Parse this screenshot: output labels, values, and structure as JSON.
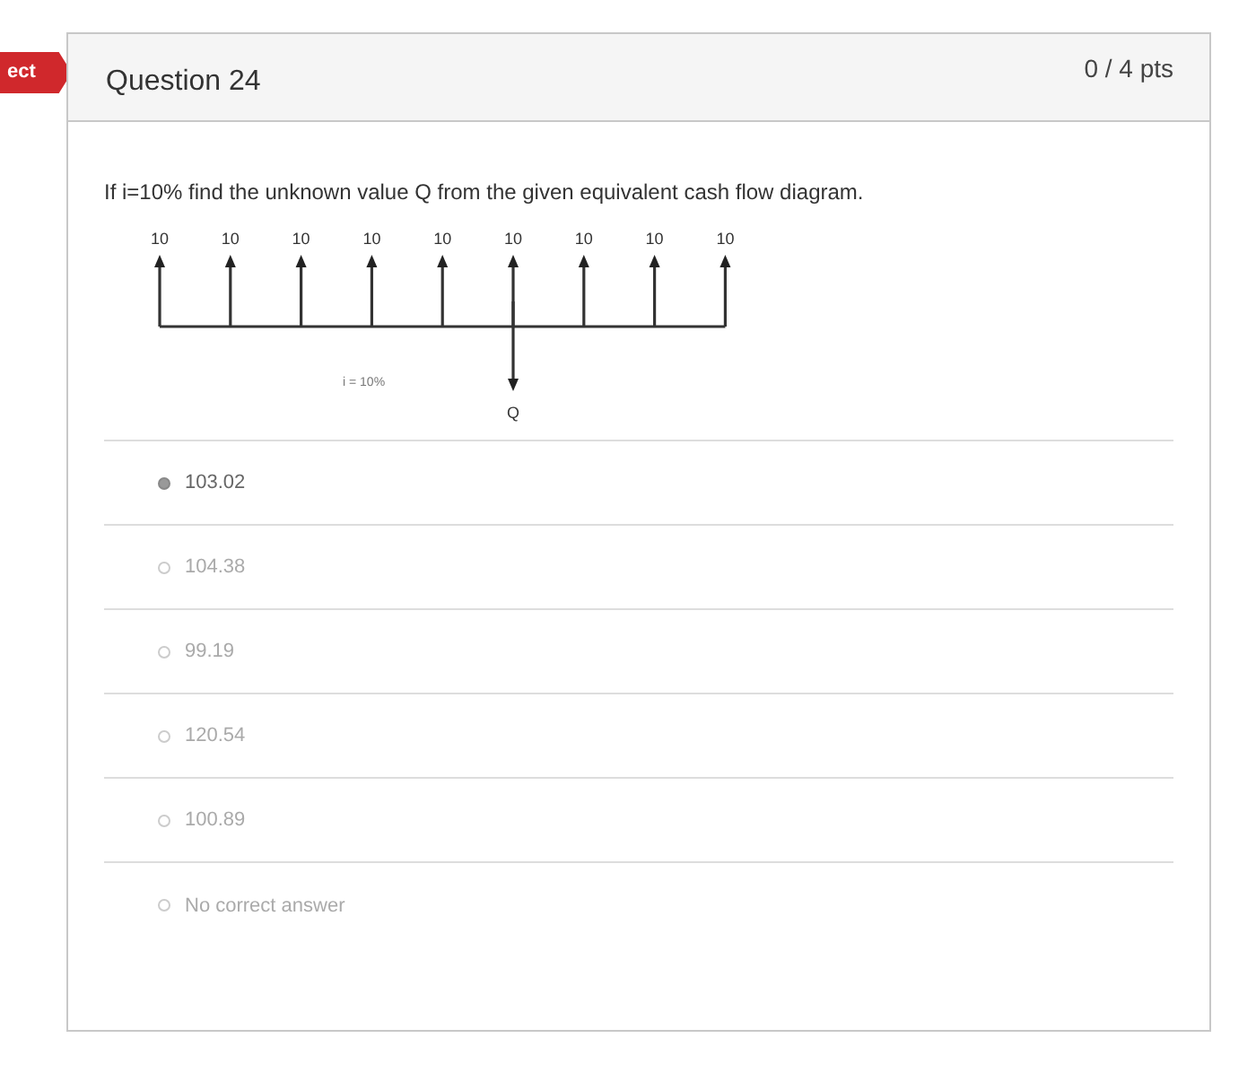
{
  "status_badge": "ect",
  "question": {
    "title": "Question 24",
    "points": "0 / 4 pts",
    "prompt": "If i=10% find the unknown value Q from the given equivalent cash flow diagram.",
    "diagram": {
      "inflows": [
        {
          "label": "10",
          "outflow": false
        },
        {
          "label": "10",
          "outflow": false
        },
        {
          "label": "10",
          "outflow": false
        },
        {
          "label": "10",
          "outflow": false
        },
        {
          "label": "10",
          "outflow": false
        },
        {
          "label": "10",
          "outflow": true
        },
        {
          "label": "10",
          "outflow": false
        },
        {
          "label": "10",
          "outflow": false
        },
        {
          "label": "10",
          "outflow": false
        }
      ],
      "rate_label": "i = 10%",
      "outflow_label": "Q"
    },
    "options": [
      {
        "label": "103.02",
        "selected": true
      },
      {
        "label": "104.38",
        "selected": false
      },
      {
        "label": "99.19",
        "selected": false
      },
      {
        "label": "120.54",
        "selected": false
      },
      {
        "label": "100.89",
        "selected": false
      },
      {
        "label": "No correct answer",
        "selected": false
      }
    ]
  }
}
